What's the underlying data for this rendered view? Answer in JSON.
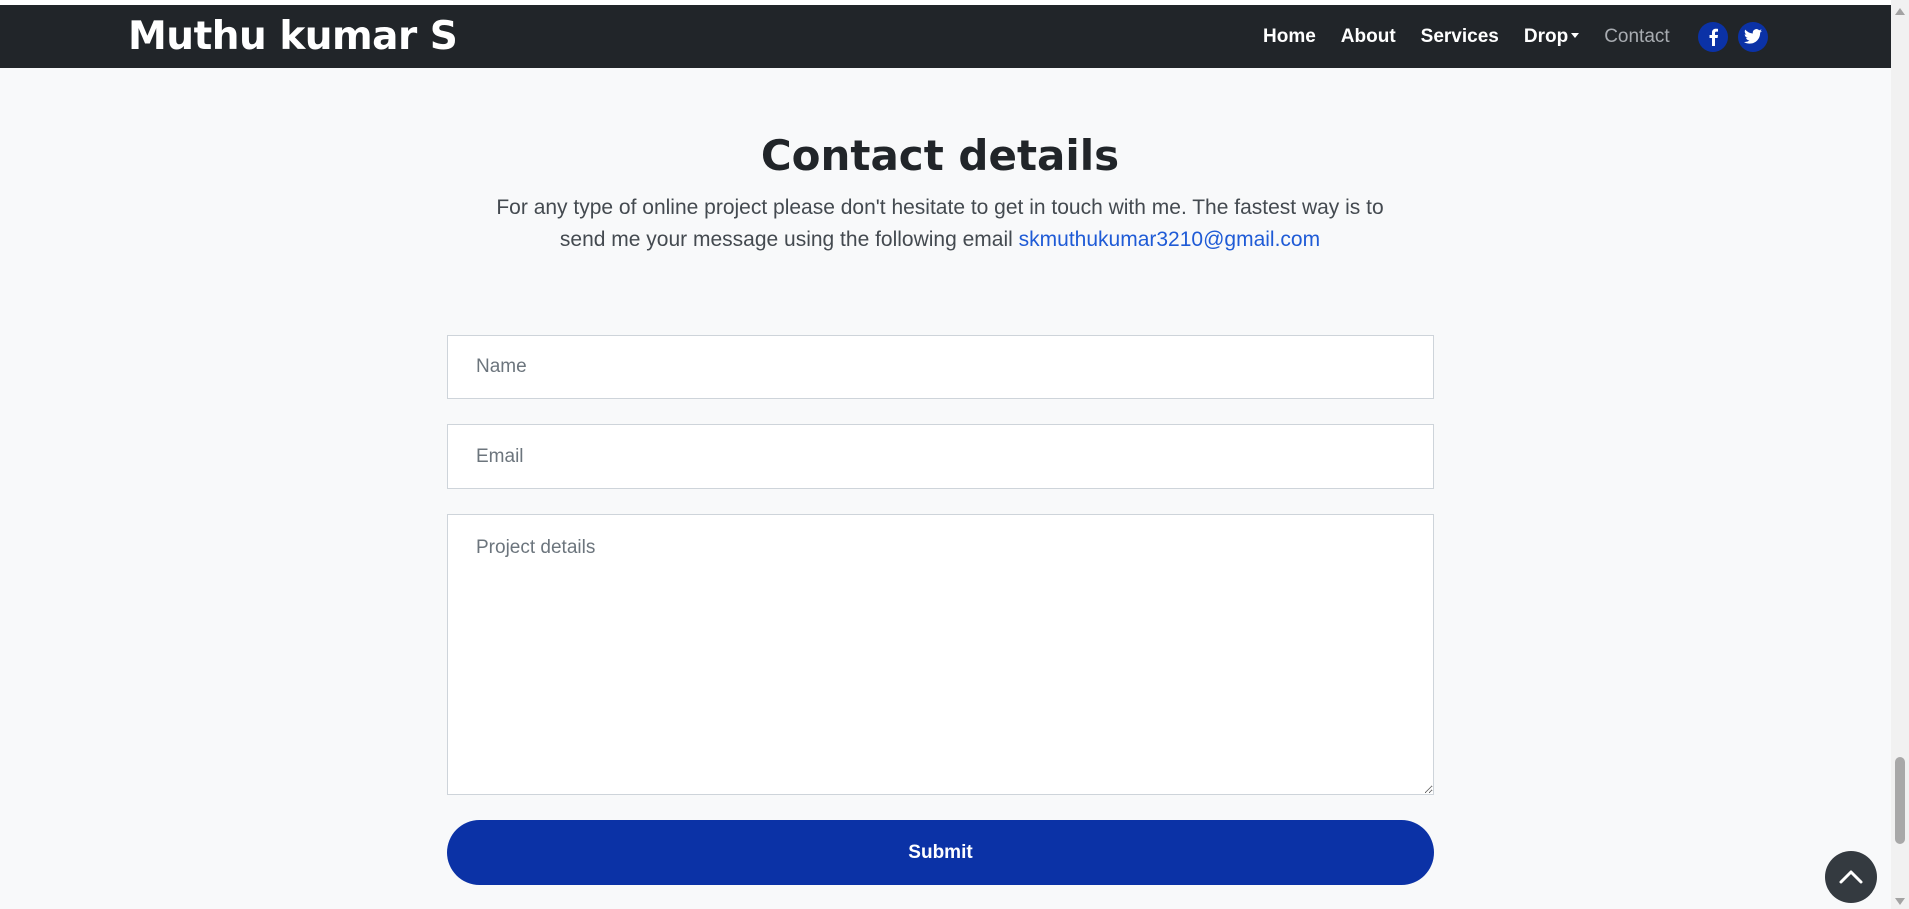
{
  "navbar": {
    "brand": "Muthu kumar S",
    "links": [
      "Home",
      "About",
      "Services",
      "Drop",
      "Contact"
    ],
    "social": [
      "facebook-icon",
      "twitter-icon"
    ],
    "social_color": "#0b32a6"
  },
  "contact": {
    "title": "Contact details",
    "lead": "For any type of online project please don't hesitate to get in touch with me. The fastest way is to send me your message using the following email",
    "email": "skmuthukumar3210@gmail.com"
  },
  "form": {
    "name_placeholder": "Name",
    "email_placeholder": "Email",
    "details_placeholder": "Project details",
    "submit_label": "Submit"
  },
  "colors": {
    "navbar_bg": "#212529",
    "primary": "#0b32a6",
    "link": "#1f5bd6",
    "page_bg": "#f8f9fa"
  }
}
